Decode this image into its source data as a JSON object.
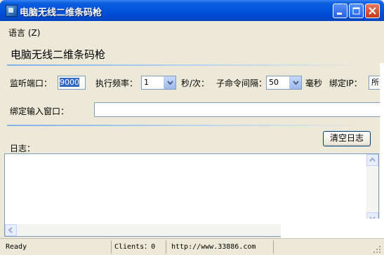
{
  "window": {
    "title": "电脑无线二维条码枪",
    "heading": "电脑无线二维条码枪"
  },
  "menu": {
    "language": "语言 (Z)"
  },
  "form": {
    "port_label": "监听端口：",
    "port_value": "9000",
    "freq_label": "执行频率：",
    "freq_value": "1",
    "freq_unit": "秒/次：",
    "interval_label": "子命令间隔：",
    "interval_value": "50",
    "interval_unit": "毫秒",
    "bindip_label": "绑定IP：",
    "bindip_value": "所有",
    "bindwin_label": "绑定输入窗口：",
    "bindwin_value": ""
  },
  "log": {
    "label": "日志：",
    "clear_button": "清空日志"
  },
  "status": {
    "ready": "Ready",
    "clients": "Clients：0",
    "url": "http://www.33886.com"
  },
  "colors": {
    "titlebar": "#0050d8",
    "accent": "#316ac5",
    "face": "#ece9d8"
  }
}
